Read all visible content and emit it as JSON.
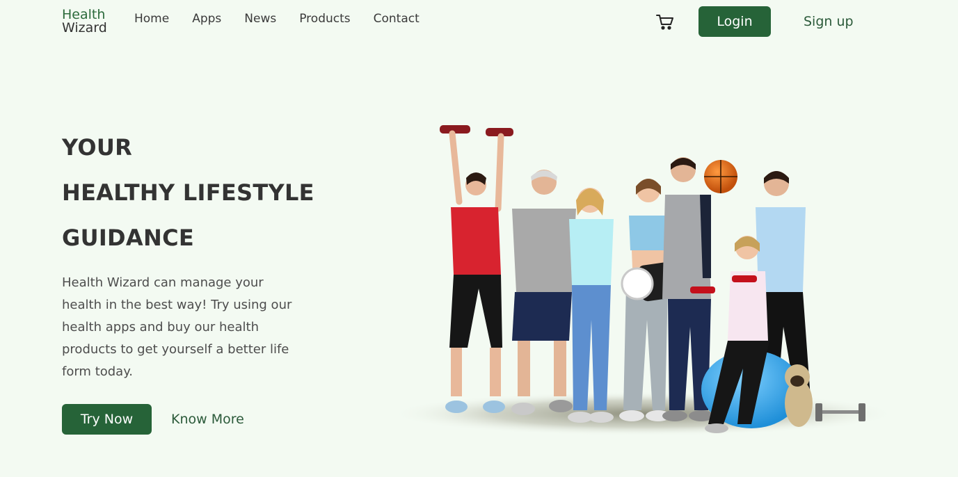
{
  "header": {
    "logo": {
      "line1": "Health",
      "line2": "Wizard"
    },
    "nav": [
      {
        "label": "Home"
      },
      {
        "label": "Apps"
      },
      {
        "label": "News"
      },
      {
        "label": "Products"
      },
      {
        "label": "Contact"
      }
    ],
    "cart_icon": "shopping-cart-icon",
    "login_label": "Login",
    "signup_label": "Sign up"
  },
  "hero": {
    "headline": [
      "YOUR",
      "HEALTHY LIFESTYLE",
      "GUIDANCE"
    ],
    "description": "Health Wizard can manage your health in the best way! Try using our health apps and buy our health products to get yourself a better life form today.",
    "primary_button": "Try Now",
    "secondary_button": "Know More",
    "image": "group-fitness-people-photo"
  },
  "colors": {
    "background": "#f3faf2",
    "brand_green": "#266338",
    "text_dark": "#333333"
  }
}
